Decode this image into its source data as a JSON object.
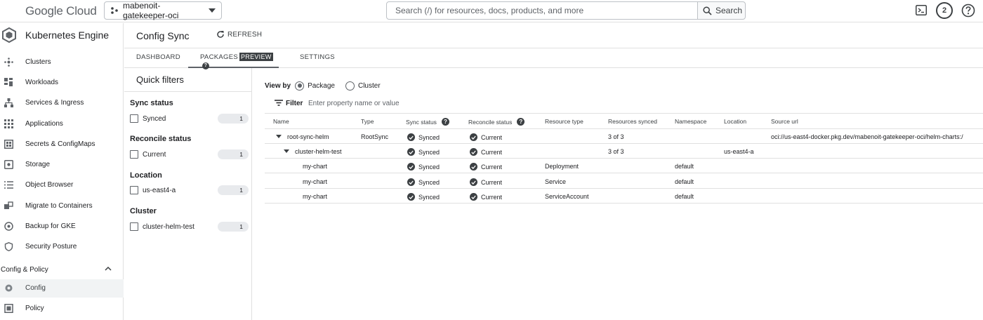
{
  "topbar": {
    "logo_google": "Google",
    "logo_cloud": "Cloud",
    "project": "mabenoit-gatekeeper-oci",
    "search_placeholder": "Search (/) for resources, docs, products, and more",
    "search_button": "Search",
    "notifications_count": "2"
  },
  "sidebar": {
    "title": "Kubernetes Engine",
    "items": [
      {
        "label": "Clusters",
        "icon": "clusters-icon"
      },
      {
        "label": "Workloads",
        "icon": "workloads-icon"
      },
      {
        "label": "Services & Ingress",
        "icon": "services-icon"
      },
      {
        "label": "Applications",
        "icon": "applications-icon"
      },
      {
        "label": "Secrets & ConfigMaps",
        "icon": "secrets-icon"
      },
      {
        "label": "Storage",
        "icon": "storage-icon"
      },
      {
        "label": "Object Browser",
        "icon": "object-browser-icon"
      },
      {
        "label": "Migrate to Containers",
        "icon": "migrate-icon"
      },
      {
        "label": "Backup for GKE",
        "icon": "backup-icon"
      },
      {
        "label": "Security Posture",
        "icon": "security-icon"
      }
    ],
    "section": "Config & Policy",
    "section_items": [
      {
        "label": "Config",
        "icon": "config-icon"
      },
      {
        "label": "Policy",
        "icon": "policy-icon"
      }
    ]
  },
  "header": {
    "title": "Config Sync",
    "refresh": "REFRESH"
  },
  "tabs": {
    "dashboard": "DASHBOARD",
    "packages": "PACKAGES",
    "preview": "PREVIEW",
    "settings": "SETTINGS"
  },
  "quick_filters": {
    "title": "Quick filters",
    "groups": [
      {
        "title": "Sync status",
        "option": "Synced",
        "count": "1"
      },
      {
        "title": "Reconcile status",
        "option": "Current",
        "count": "1"
      },
      {
        "title": "Location",
        "option": "us-east4-a",
        "count": "1"
      },
      {
        "title": "Cluster",
        "option": "cluster-helm-test",
        "count": "1"
      }
    ]
  },
  "main": {
    "view_by": "View by",
    "view_package": "Package",
    "view_cluster": "Cluster",
    "filter_label": "Filter",
    "filter_placeholder": "Enter property name or value"
  },
  "table": {
    "columns": [
      "Name",
      "Type",
      "Sync status",
      "Reconcile status",
      "Resource type",
      "Resources synced",
      "Namespace",
      "Location",
      "Source url"
    ],
    "rows": [
      {
        "name": "root-sync-helm",
        "type": "RootSync",
        "sync": "Synced",
        "reconcile": "Current",
        "resource_type": "",
        "resources_synced": "3 of 3",
        "namespace": "",
        "location": "",
        "source_url": "oci://us-east4-docker.pkg.dev/mabenoit-gatekeeper-oci/helm-charts:/"
      },
      {
        "name": "cluster-helm-test",
        "type": "",
        "sync": "Synced",
        "reconcile": "Current",
        "resource_type": "",
        "resources_synced": "3 of 3",
        "namespace": "",
        "location": "us-east4-a",
        "source_url": ""
      },
      {
        "name": "my-chart",
        "type": "",
        "sync": "Synced",
        "reconcile": "Current",
        "resource_type": "Deployment",
        "resources_synced": "",
        "namespace": "default",
        "location": "",
        "source_url": ""
      },
      {
        "name": "my-chart",
        "type": "",
        "sync": "Synced",
        "reconcile": "Current",
        "resource_type": "Service",
        "resources_synced": "",
        "namespace": "default",
        "location": "",
        "source_url": ""
      },
      {
        "name": "my-chart",
        "type": "",
        "sync": "Synced",
        "reconcile": "Current",
        "resource_type": "ServiceAccount",
        "resources_synced": "",
        "namespace": "default",
        "location": "",
        "source_url": ""
      }
    ]
  }
}
